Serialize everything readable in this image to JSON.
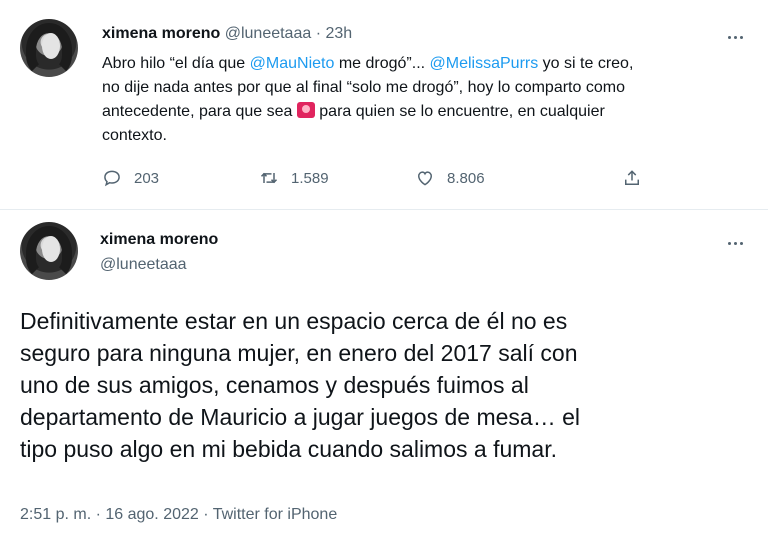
{
  "tweet1": {
    "display_name": "ximena moreno",
    "handle": "@luneetaaa",
    "separator": " · ",
    "time": "23h",
    "text_lines": [
      [
        "Abro hilo  “el día que ",
        "@MauNieto",
        " me drogó”... ",
        "@MelissaPurrs",
        " yo si te creo,"
      ],
      "no dije nada antes por que al final “solo me drogó”, hoy lo comparto como",
      [
        "antecedente, para que sea ",
        "🚨",
        " para quien se lo encuentre, en cualquier"
      ],
      "contexto."
    ],
    "line1": {
      "a": "Abro hilo  “el día que ",
      "mention1": "@MauNieto",
      "b": " me drogó”... ",
      "mention2": "@MelissaPurrs",
      "c": " yo si te creo,"
    },
    "line2": "no dije nada antes por que al final “solo me drogó”, hoy lo comparto como",
    "line3": {
      "a": "antecedente, para que sea ",
      "c": " para quien se lo encuentre, en cualquier"
    },
    "line4": "contexto.",
    "replies": "203",
    "retweets": "1.589",
    "likes": "8.806"
  },
  "tweet2": {
    "display_name": "ximena moreno",
    "handle": "@luneetaaa",
    "lines": [
      "Definitivamente estar en un espacio cerca de él no es",
      "seguro para ninguna mujer, en enero del 2017 salí con",
      "uno de sus amigos, cenamos y después fuimos al",
      "departamento de Mauricio a jugar juegos de mesa… el",
      "tipo puso algo en mi bebida cuando salimos a fumar."
    ],
    "meta": "2:51 p. m. · 16 ago. 2022 · Twitter for iPhone"
  },
  "colors": {
    "mention": "#1d9bf0",
    "muted": "#536471",
    "text": "#0f1419"
  },
  "icons": [
    "more-icon",
    "reply-icon",
    "retweet-icon",
    "like-icon",
    "share-icon",
    "siren-emoji"
  ]
}
